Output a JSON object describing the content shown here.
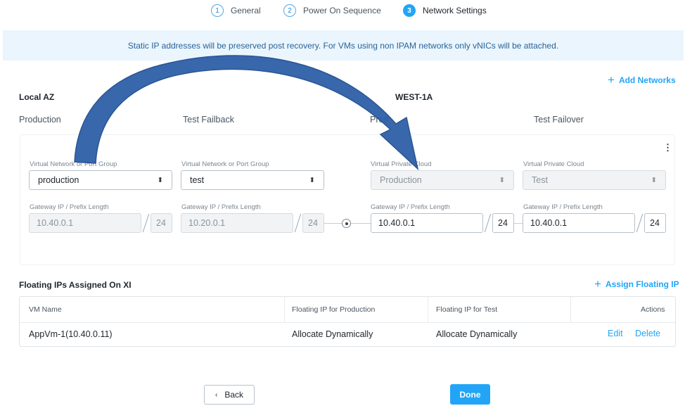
{
  "wizard": {
    "steps": [
      {
        "num": "1",
        "label": "General"
      },
      {
        "num": "2",
        "label": "Power On Sequence"
      },
      {
        "num": "3",
        "label": "Network Settings"
      }
    ]
  },
  "banner": "Static IP addresses will be preserved post recovery. For VMs using non IPAM networks only vNICs will be attached.",
  "add_networks": "Add Networks",
  "local_az": "Local AZ",
  "remote_az": "WEST-1A",
  "columns": {
    "production": "Production",
    "test_failback": "Test Failback",
    "production_remote": "Prod",
    "test_failover": "Test Failover"
  },
  "network": {
    "local_prod": {
      "group_label": "Virtual Network or Port Group",
      "value": "production",
      "gw_label": "Gateway IP / Prefix Length",
      "gateway": "10.40.0.1",
      "prefix": "24"
    },
    "local_test": {
      "group_label": "Virtual Network or Port Group",
      "value": "test",
      "gw_label": "Gateway IP / Prefix Length",
      "gateway": "10.20.0.1",
      "prefix": "24"
    },
    "remote_prod": {
      "group_label": "Virtual Private Cloud",
      "value": "Production",
      "gw_label": "Gateway IP / Prefix Length",
      "gateway": "10.40.0.1",
      "prefix": "24"
    },
    "remote_test": {
      "group_label": "Virtual Private Cloud",
      "value": "Test",
      "gw_label": "Gateway IP / Prefix Length",
      "gateway": "10.40.0.1",
      "prefix": "24"
    }
  },
  "floating": {
    "title": "Floating IPs Assigned On XI",
    "assign_label": "Assign Floating IP",
    "headers": {
      "vm": "VM Name",
      "prod": "Floating IP for Production",
      "test": "Floating IP for Test",
      "actions": "Actions"
    },
    "rows": [
      {
        "vm": "AppVm-1(10.40.0.11)",
        "prod": "Allocate Dynamically",
        "test": "Allocate Dynamically",
        "edit": "Edit",
        "delete": "Delete"
      }
    ]
  },
  "footer": {
    "back": "Back",
    "done": "Done"
  },
  "icons": {
    "plus": "plus-icon",
    "caret": "select-caret-icon",
    "back": "chevron-left-icon",
    "menu": "more-vertical-icon"
  },
  "colors": {
    "accent": "#22a5f7",
    "banner_bg": "#eaf5fd",
    "arrow": "#2f5fa8"
  }
}
